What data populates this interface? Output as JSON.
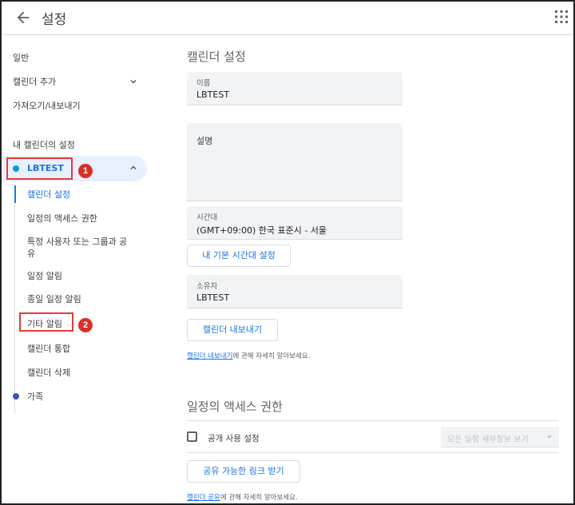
{
  "header": {
    "title": "설정"
  },
  "sidebar": {
    "general": "일반",
    "add_calendar": "캘린더 추가",
    "import_export": "가져오기/내보내기",
    "my_calendars_heading": "내 캘린더의 설정",
    "calendar_name": "LBTEST",
    "sub_items": [
      "캘린더 설정",
      "일정의 액세스 권한",
      "특정 사용자 또는 그룹과 공",
      "유",
      "일정 알림",
      "종일 일정 알림",
      "기타 알림",
      "캘린더 통합",
      "캘린더 삭제"
    ],
    "family": "가족",
    "badges": [
      "1",
      "2"
    ]
  },
  "main": {
    "calendar_settings_title": "캘린더 설정",
    "name_field": {
      "label": "이름",
      "value": "LBTEST"
    },
    "description_field": {
      "label": "설명"
    },
    "timezone_field": {
      "label": "시간대",
      "value": "(GMT+09:00) 한국 표준시 - 서울"
    },
    "default_timezone_button": "내 기본 시간대 설정",
    "owner_field": {
      "label": "소유자",
      "value": "LBTEST"
    },
    "export_button": "캘린더 내보내기",
    "export_help_link": "캘린더 내보내기",
    "export_help_suffix": "에 관해 자세히 알아보세요.",
    "access_title": "일정의 액세스 권한",
    "public_checkbox_label": "공개 사용 설정",
    "public_select_value": "모든 일정 세부정보 보기",
    "share_link_button": "공유 가능한 링크 받기",
    "share_help_link": "캘린더 공유",
    "share_help_suffix": "에 관해 자세히 알아보세요."
  },
  "colors": {
    "accent": "#1a73e8",
    "calendar_dot": "#039be5",
    "family_dot": "#3f51b5",
    "highlight_box": "#e53935"
  }
}
